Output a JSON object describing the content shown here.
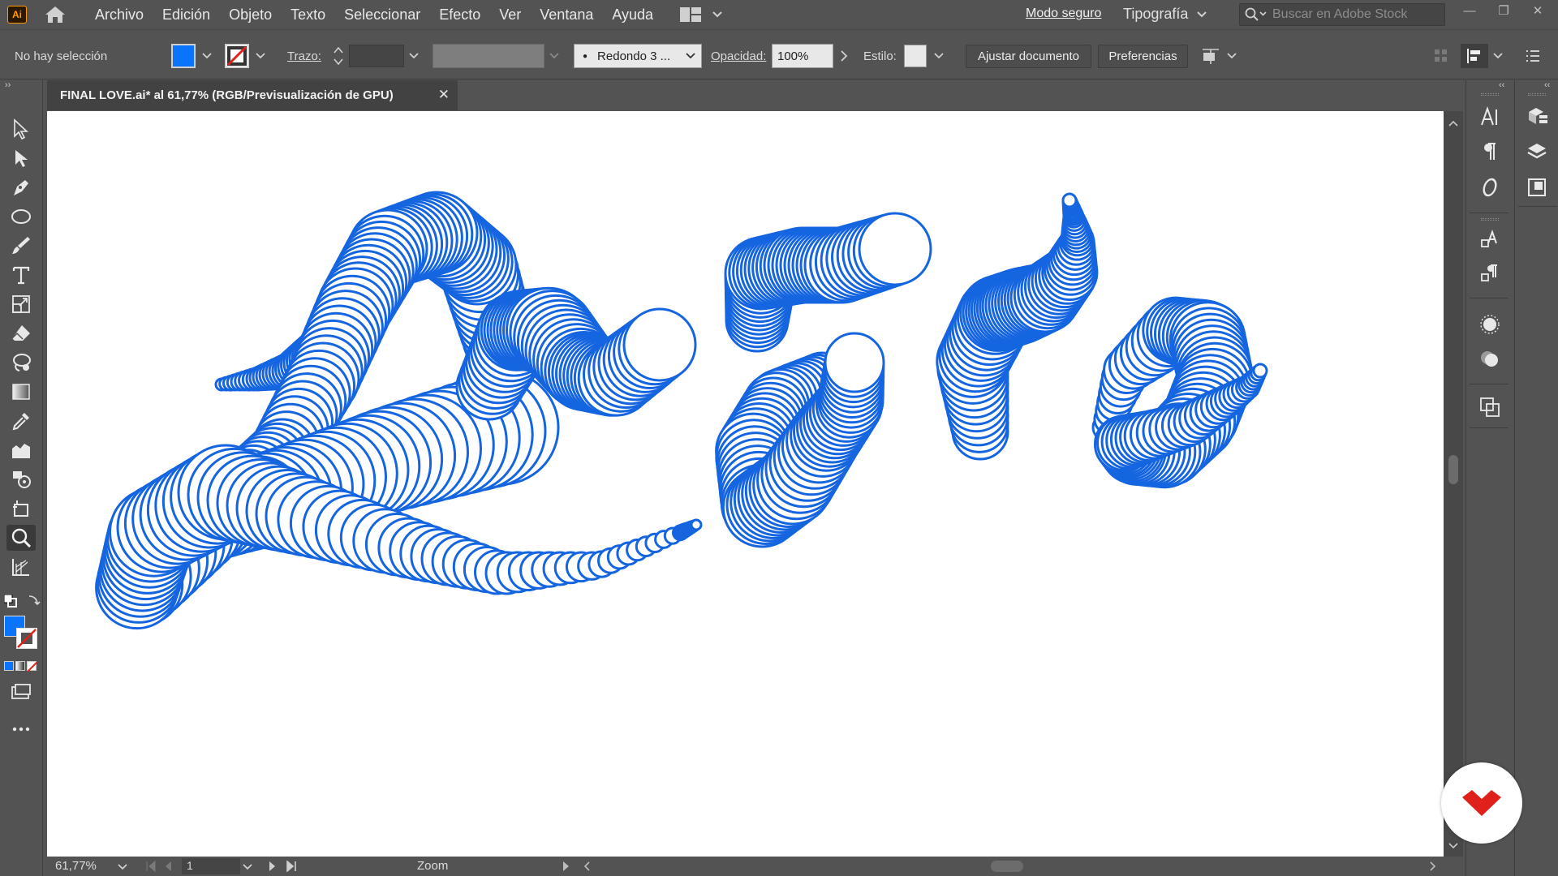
{
  "app": {
    "logo_text": "Ai",
    "brand_color": "#ff9a00",
    "accent_color": "#0a74ff"
  },
  "menu": {
    "items": [
      "Archivo",
      "Edición",
      "Objeto",
      "Texto",
      "Seleccionar",
      "Efecto",
      "Ver",
      "Ventana",
      "Ayuda"
    ],
    "mode_link": "Modo seguro",
    "workspace_label": "Tipografía",
    "search_placeholder": "Buscar en Adobe Stock"
  },
  "control_bar": {
    "selection_status": "No hay selección",
    "fill_color": "#0a74ff",
    "stroke_label": "Trazo:",
    "brush_label": "Redondo 3 ...",
    "opacity_label": "Opacidad:",
    "opacity_value": "100%",
    "style_label": "Estilo:",
    "document_setup_button": "Ajustar documento",
    "preferences_button": "Preferencias"
  },
  "document": {
    "tab_title": "FINAL LOVE.ai* al 61,77% (RGB/Previsualización de GPU)",
    "close_glyph": "✕",
    "artwork_color": "#1565e0"
  },
  "status_bar": {
    "zoom": "61,77%",
    "artboard_number": "1",
    "tool_label": "Zoom"
  },
  "tools": [
    "selection-tool",
    "direct-selection-tool",
    "pen-tool",
    "ellipse-tool",
    "paintbrush-tool",
    "type-tool",
    "scale-tool",
    "eraser-tool",
    "lasso-tool",
    "gradient-tool",
    "eyedropper-tool",
    "chart-tool",
    "shape-builder-tool",
    "artboard-tool",
    "zoom-tool",
    "perspective-grid-tool"
  ],
  "active_tool": "zoom-tool"
}
